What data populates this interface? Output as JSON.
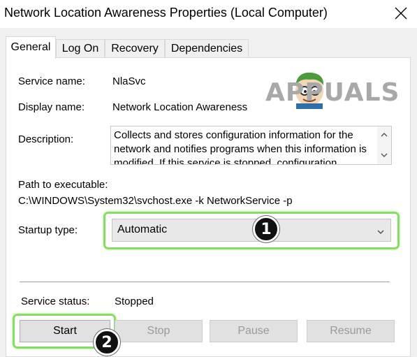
{
  "window": {
    "title": "Network Location Awareness Properties (Local Computer)",
    "close_icon": "close-icon"
  },
  "tabs": [
    {
      "label": "General",
      "active": true
    },
    {
      "label": "Log On",
      "active": false
    },
    {
      "label": "Recovery",
      "active": false
    },
    {
      "label": "Dependencies",
      "active": false
    }
  ],
  "general": {
    "service_name_label": "Service name:",
    "service_name_value": "NlaSvc",
    "display_name_label": "Display name:",
    "display_name_value": "Network Location Awareness",
    "description_label": "Description:",
    "description_text": "Collects and stores configuration information for the network and notifies programs when this information is modified. If this service is stopped, configuration",
    "path_label": "Path to executable:",
    "path_value": "C:\\WINDOWS\\System32\\svchost.exe -k NetworkService -p",
    "startup_type_label": "Startup type:",
    "startup_type_value": "Automatic",
    "service_status_label": "Service status:",
    "service_status_value": "Stopped"
  },
  "buttons": {
    "start": "Start",
    "stop": "Stop",
    "pause": "Pause",
    "resume": "Resume"
  },
  "annotations": {
    "badge_1": "1",
    "badge_2": "2"
  },
  "watermark": {
    "text": "APPUALS"
  },
  "colors": {
    "highlight_green": "#86dd63",
    "badge_black": "#111111"
  }
}
